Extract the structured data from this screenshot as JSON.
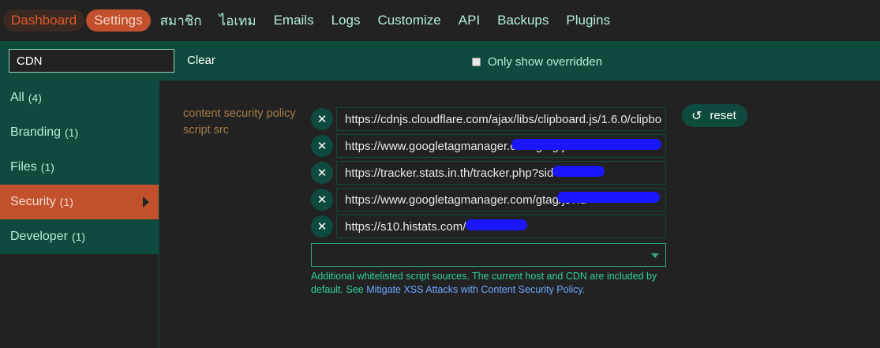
{
  "nav": {
    "items": [
      "Dashboard",
      "Settings",
      "สมาชิก",
      "ไอเทม",
      "Emails",
      "Logs",
      "Customize",
      "API",
      "Backups",
      "Plugins"
    ]
  },
  "filter": {
    "value": "CDN",
    "clear_label": "Clear",
    "only_overridden_label": "Only show overridden"
  },
  "sidebar": {
    "items": [
      {
        "label": "All",
        "count": "(4)"
      },
      {
        "label": "Branding",
        "count": "(1)"
      },
      {
        "label": "Files",
        "count": "(1)"
      },
      {
        "label": "Security",
        "count": "(1)"
      },
      {
        "label": "Developer",
        "count": "(1)"
      }
    ]
  },
  "setting": {
    "label_line1": "content security policy",
    "label_line2": "script src",
    "values": [
      "https://cdnjs.cloudflare.com/ajax/libs/clipboard.js/1.6.0/clipbo",
      "https://www.googletagmanager.com/gtag/js?id",
      "https://tracker.stats.in.th/tracker.php?sid",
      "https://www.googletagmanager.com/gtag/js?id",
      "https://s10.histats.com/"
    ],
    "remove_icon": "x-icon",
    "reset_label": "reset",
    "reset_icon": "undo-icon",
    "description_text": "Additional whitelisted script sources. The current host and CDN are included by default. See ",
    "description_link": "Mitigate XSS Attacks with Content Security Policy",
    "description_end": "."
  },
  "colors": {
    "accent": "#c2502d",
    "panel": "#0e4a3d",
    "text_mint": "#b4f0d7",
    "label_brown": "#a67d4a",
    "desc_green": "#2fd39a",
    "link_blue": "#6ea8ff"
  }
}
